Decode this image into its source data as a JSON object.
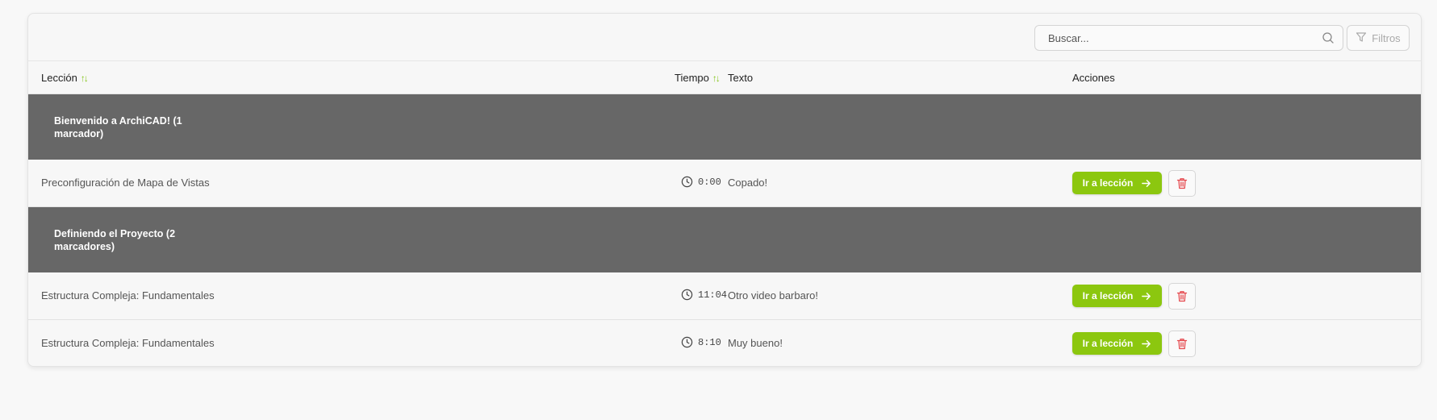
{
  "toolbar": {
    "search_placeholder": "Buscar...",
    "search_icon": "search-icon",
    "filters_label": "Filtros",
    "filters_icon": "filter-icon"
  },
  "columns": {
    "lesson": "Lección",
    "time": "Tiempo",
    "text": "Texto",
    "actions": "Acciones"
  },
  "groups": [
    {
      "title": "Bienvenido a ArchiCAD! (1 marcador)",
      "rows": [
        {
          "lesson": "Preconfiguración de Mapa de Vistas",
          "time": "0:00",
          "text": "Copado!"
        }
      ]
    },
    {
      "title": "Definiendo el Proyecto (2 marcadores)",
      "rows": [
        {
          "lesson": "Estructura Compleja: Fundamentales",
          "time": "11:04",
          "text": "Otro video barbaro!"
        },
        {
          "lesson": "Estructura Compleja: Fundamentales",
          "time": "8:10",
          "text": "Muy bueno!"
        }
      ]
    }
  ],
  "actions": {
    "go_label": "Ir a lección",
    "go_icon": "arrow-right-icon",
    "delete_icon": "trash-icon"
  },
  "colors": {
    "accent": "#8cc70f",
    "group_bg": "#676767",
    "delete": "#e5484d"
  }
}
